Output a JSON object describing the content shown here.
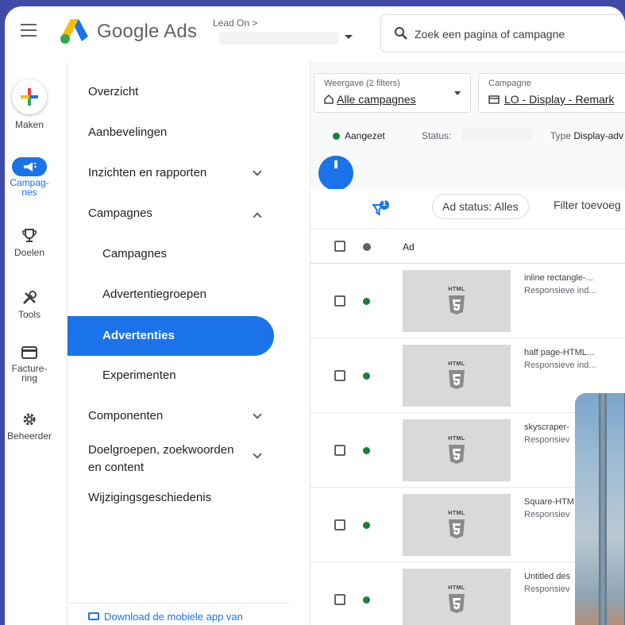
{
  "header": {
    "brand": "Google Ads",
    "account_label": "Lead On >",
    "search_placeholder": "Zoek een pagina of campagne"
  },
  "rail": [
    {
      "label": "Maken",
      "icon": "plus-icon"
    },
    {
      "label": "Campag-\nnes",
      "icon": "megaphone-icon"
    },
    {
      "label": "Doelen",
      "icon": "trophy-icon"
    },
    {
      "label": "Tools",
      "icon": "tools-icon"
    },
    {
      "label": "Facture-\nring",
      "icon": "credit-card-icon"
    },
    {
      "label": "Beheerder",
      "icon": "gear-icon"
    }
  ],
  "nav": {
    "overview": "Overzicht",
    "recommendations": "Aanbevelingen",
    "insights": "Inzichten en rapporten",
    "campaigns_group": "Campagnes",
    "campaigns": "Campagnes",
    "ad_groups": "Advertentiegroepen",
    "ads": "Advertenties",
    "experiments": "Experimenten",
    "components": "Componenten",
    "audiences_line1": "Doelgroepen, zoekwoorden",
    "audiences_line2": "en content",
    "history": "Wijzigingsgeschiedenis",
    "download_app": "Download de mobiele app van"
  },
  "filters": {
    "view_label": "Weergave (2 filters)",
    "view_value": "Alle campagnes",
    "campaign_label": "Campagne",
    "campaign_value": "LO - Display - Remark",
    "enabled": "Aangezet",
    "status_label": "Status:",
    "type_label": "Type",
    "type_value": "Display-adv"
  },
  "toolbar": {
    "filter_badge": "1",
    "chip": "Ad status: Alles",
    "add_filter": "Filter toevoeg"
  },
  "table": {
    "col_ad": "Ad",
    "thumb_text": "HTML",
    "rows": [
      {
        "name": "inline rectangle-...",
        "type": "Responsieve ind..."
      },
      {
        "name": "half page-HTML...",
        "type": "Responsieve ind..."
      },
      {
        "name": "skyscraper-",
        "type": "Responsiev"
      },
      {
        "name": "Square-HTM",
        "type": "Responsiev"
      },
      {
        "name": "Untitled des",
        "type": "Responsiev"
      }
    ]
  },
  "colors": {
    "accent": "#1a73e8",
    "status_green": "#188038",
    "page_bg": "#3f4aa8"
  }
}
